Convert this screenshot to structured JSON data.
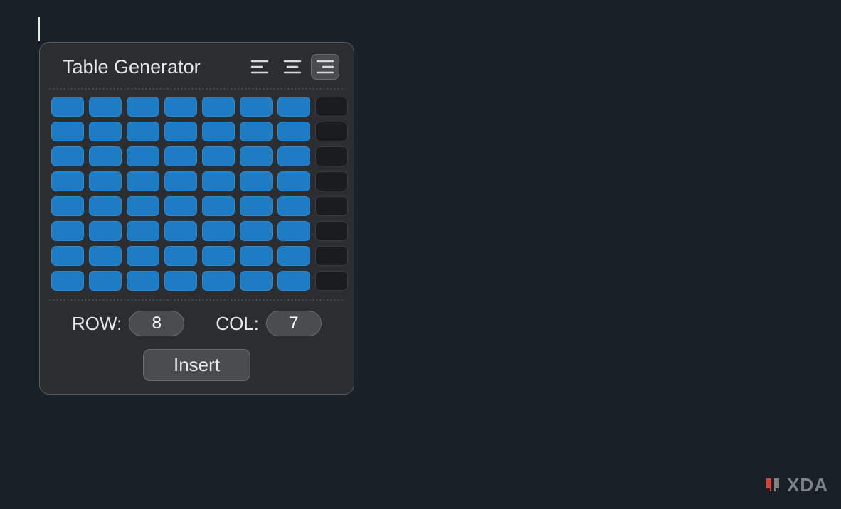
{
  "panel": {
    "title": "Table Generator",
    "alignment": {
      "options": [
        "left",
        "center",
        "right"
      ],
      "active": "right"
    },
    "grid": {
      "total_rows": 8,
      "total_cols": 8,
      "selected_rows": 8,
      "selected_cols": 7
    },
    "row_label": "ROW:",
    "col_label": "COL:",
    "row_value": "8",
    "col_value": "7",
    "insert_label": "Insert"
  },
  "watermark": {
    "text": "XDA"
  }
}
